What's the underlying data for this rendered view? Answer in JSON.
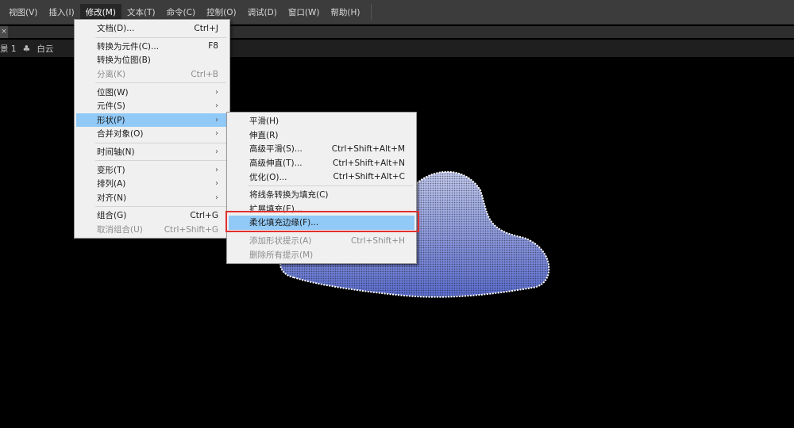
{
  "menubar": {
    "items": [
      "视图(V)",
      "插入(I)",
      "修改(M)",
      "文本(T)",
      "命令(C)",
      "控制(O)",
      "调试(D)",
      "窗口(W)",
      "帮助(H)"
    ],
    "active_index": 2
  },
  "tab": {
    "close": "×"
  },
  "stagebar": {
    "scene": "景 1",
    "symbol": "白云"
  },
  "modify_menu": [
    {
      "label": "文档(D)...",
      "shortcut": "Ctrl+J"
    },
    {
      "sep": true
    },
    {
      "label": "转换为元件(C)...",
      "shortcut": "F8"
    },
    {
      "label": "转换为位图(B)",
      "shortcut": ""
    },
    {
      "label": "分离(K)",
      "shortcut": "Ctrl+B",
      "disabled": true
    },
    {
      "sep": true
    },
    {
      "label": "位图(W)",
      "submenu": true
    },
    {
      "label": "元件(S)",
      "submenu": true
    },
    {
      "label": "形状(P)",
      "submenu": true,
      "highlighted": true
    },
    {
      "label": "合并对象(O)",
      "submenu": true
    },
    {
      "sep": true
    },
    {
      "label": "时间轴(N)",
      "submenu": true
    },
    {
      "sep": true
    },
    {
      "label": "变形(T)",
      "submenu": true
    },
    {
      "label": "排列(A)",
      "submenu": true
    },
    {
      "label": "对齐(N)",
      "submenu": true
    },
    {
      "sep": true
    },
    {
      "label": "组合(G)",
      "shortcut": "Ctrl+G"
    },
    {
      "label": "取消组合(U)",
      "shortcut": "Ctrl+Shift+G",
      "disabled": true
    }
  ],
  "shape_menu": [
    {
      "label": "平滑(H)",
      "shortcut": ""
    },
    {
      "label": "伸直(R)",
      "shortcut": ""
    },
    {
      "label": "高级平滑(S)...",
      "shortcut": "Ctrl+Shift+Alt+M"
    },
    {
      "label": "高级伸直(T)...",
      "shortcut": "Ctrl+Shift+Alt+N"
    },
    {
      "label": "优化(O)...",
      "shortcut": "Ctrl+Shift+Alt+C"
    },
    {
      "sep": true
    },
    {
      "label": "将线条转换为填充(C)",
      "shortcut": ""
    },
    {
      "label": "扩展填充(E)...",
      "shortcut": ""
    },
    {
      "label": "柔化填充边缘(F)...",
      "shortcut": "",
      "highlighted": true
    },
    {
      "sep": true
    },
    {
      "label": "添加形状提示(A)",
      "shortcut": "Ctrl+Shift+H",
      "disabled": true
    },
    {
      "label": "删除所有提示(M)",
      "shortcut": "",
      "disabled": true
    }
  ],
  "colors": {
    "highlight": "#91c9f7",
    "callout": "#e03030",
    "cloud_top": "#b8c2ee",
    "cloud_bottom": "#5e6fd0"
  }
}
